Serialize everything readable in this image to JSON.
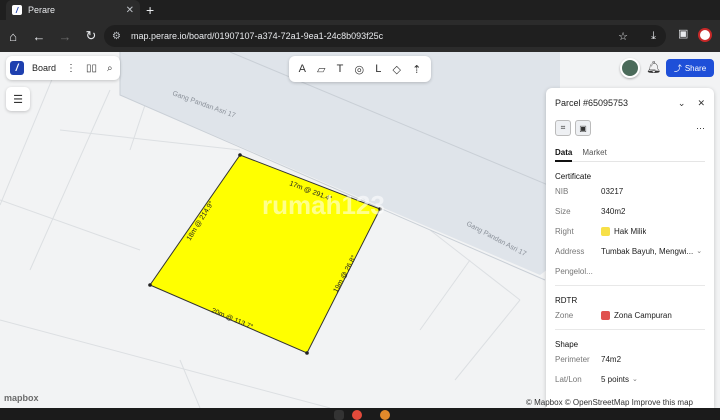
{
  "browser": {
    "tab_title": "Perare",
    "tab_close": "✕",
    "new_tab": "+",
    "url": "map.perare.io/board/01907107-a374-72a1-9ea1-24c8b093f25c"
  },
  "board": {
    "label": "Board"
  },
  "map": {
    "street_labels": [
      "Gang Pandan Asri 17",
      "Gang Pandan Asri 17"
    ],
    "edge_labels": [
      "17m @ 291.4°",
      "18m @ 214.9°",
      "19m @ 26.8°",
      "20m @ 113.7°"
    ],
    "parcel_color": "#ffff00",
    "watermark": "rumah123"
  },
  "share": {
    "label": "Share"
  },
  "panel": {
    "title": "Parcel #65095753",
    "tabs": [
      "Data",
      "Market"
    ],
    "certificate": {
      "heading": "Certificate",
      "rows": [
        {
          "k": "NIB",
          "v": "03217"
        },
        {
          "k": "Size",
          "v": "340m2"
        },
        {
          "k": "Right",
          "v": "Hak Milik",
          "color": "#f7e048"
        },
        {
          "k": "Address",
          "v": "Tumbak Bayuh, Mengwi..."
        },
        {
          "k": "Pengelol...",
          "v": ""
        }
      ]
    },
    "rdtr": {
      "heading": "RDTR",
      "rows": [
        {
          "k": "Zone",
          "v": "Zona Campuran",
          "color": "#e0524f"
        }
      ]
    },
    "shape": {
      "heading": "Shape",
      "rows": [
        {
          "k": "Perimeter",
          "v": "74m2"
        },
        {
          "k": "Lat/Lon",
          "v": "5 points"
        }
      ]
    }
  },
  "footer": {
    "mapbox": "mapbox",
    "attribution": "© Mapbox © OpenStreetMap Improve this map"
  }
}
